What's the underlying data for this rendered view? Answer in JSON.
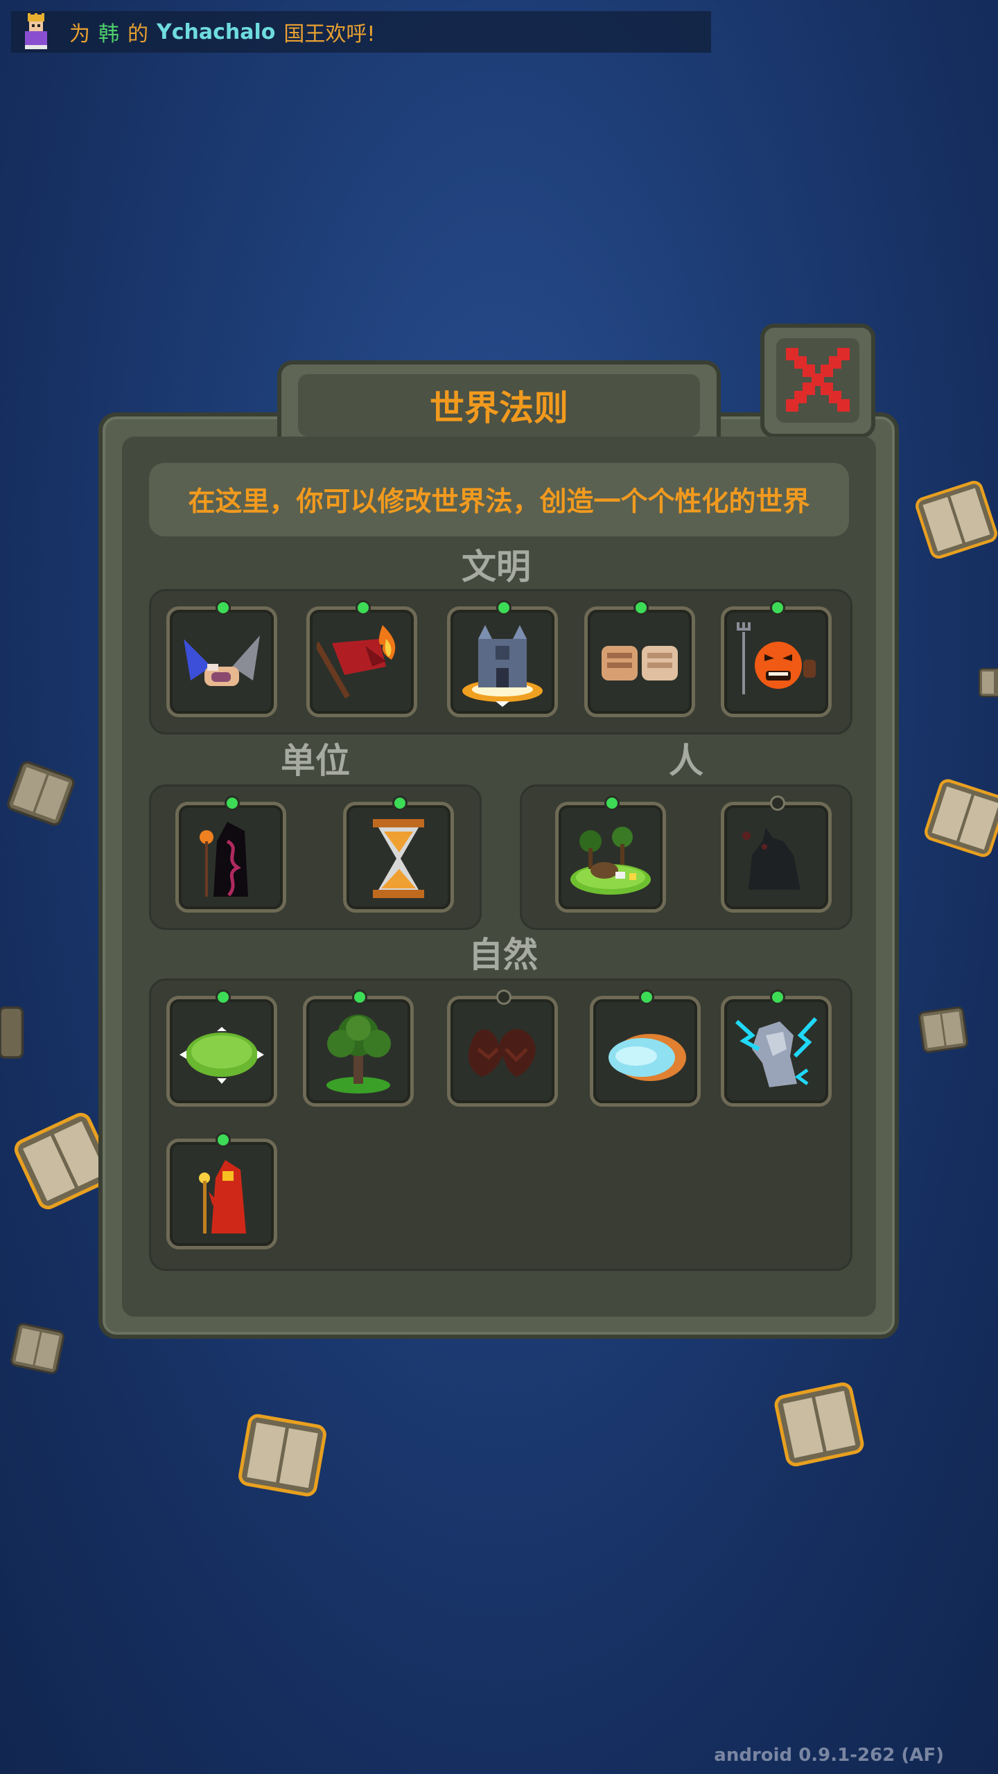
{
  "notification": {
    "prefix": "为",
    "kingdom": "韩",
    "particle": "的",
    "king_name": "Ychachalo",
    "suffix": "国王欢呼!"
  },
  "dialog": {
    "title": "世界法则",
    "subtitle": "在这里，你可以修改世界法，创造一个个性化的世界"
  },
  "sections": {
    "civilization": {
      "label": "文明",
      "items": [
        {
          "icon": "diplomacy-handshake-icon",
          "enabled": true
        },
        {
          "icon": "burning-flag-rebellion-icon",
          "enabled": true
        },
        {
          "icon": "kingdom-castle-icon",
          "enabled": true
        },
        {
          "icon": "friendship-fists-icon",
          "enabled": true
        },
        {
          "icon": "angry-mob-icon",
          "enabled": true
        }
      ]
    },
    "units": {
      "label": "单位",
      "items": [
        {
          "icon": "dark-mage-icon",
          "enabled": true
        },
        {
          "icon": "hourglass-icon",
          "enabled": true
        }
      ]
    },
    "people": {
      "label": "人",
      "items": [
        {
          "icon": "animal-island-icon",
          "enabled": true
        },
        {
          "icon": "shadow-wolf-icon",
          "enabled": false
        }
      ]
    },
    "nature": {
      "label": "自然",
      "items": [
        {
          "icon": "grass-island-icon",
          "enabled": true
        },
        {
          "icon": "bonsai-tree-icon",
          "enabled": true
        },
        {
          "icon": "lava-vines-icon",
          "enabled": false
        },
        {
          "icon": "ice-shield-icon",
          "enabled": true
        },
        {
          "icon": "lightning-dragon-icon",
          "enabled": true
        },
        {
          "icon": "fire-mage-icon",
          "enabled": true
        }
      ]
    }
  },
  "version": "android 0.9.1-262 (AF)",
  "colors": {
    "accent": "#f29a1e",
    "enabled_dot": "#3ddc56",
    "close_x": "#e02b2b",
    "background": "#1e3e78"
  }
}
